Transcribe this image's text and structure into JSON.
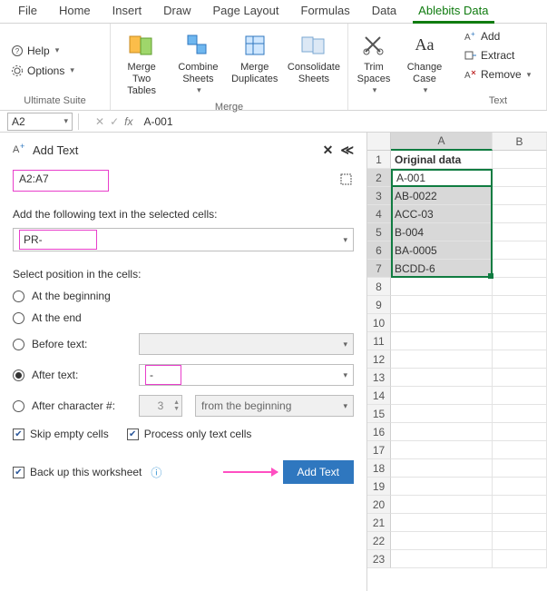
{
  "tabs": [
    "File",
    "Home",
    "Insert",
    "Draw",
    "Page Layout",
    "Formulas",
    "Data",
    "Ablebits Data"
  ],
  "active_tab": 7,
  "ribbon": {
    "ultimate": {
      "help": "Help",
      "options": "Options",
      "label": "Ultimate Suite"
    },
    "merge": {
      "mergeTables": "Merge\nTwo Tables",
      "combineSheets": "Combine\nSheets",
      "mergeDuplicates": "Merge\nDuplicates",
      "consolidateSheets": "Consolidate\nSheets",
      "label": "Merge"
    },
    "trim": {
      "label": "Trim\nSpaces"
    },
    "changeCase": {
      "label": "Change\nCase"
    },
    "text": {
      "add": "Add",
      "extract": "Extract",
      "remove": "Remove",
      "label": "Text"
    }
  },
  "formula_bar": {
    "namebox": "A2",
    "value": "A-001",
    "fx": "fx"
  },
  "pane": {
    "title": "Add Text",
    "range": "A2:A7",
    "prompt1": "Add the following text in the selected cells:",
    "text_to_add": "PR-",
    "prompt2": "Select position in the cells:",
    "opt_begin": "At the beginning",
    "opt_end": "At the end",
    "opt_before": "Before text:",
    "opt_after": "After text:",
    "after_value": "-",
    "opt_afterchar": "After character #:",
    "char_num": "3",
    "from_label": "from the beginning",
    "chk_skip": "Skip empty cells",
    "chk_textonly": "Process only text cells",
    "chk_backup": "Back up this worksheet",
    "button": "Add Text"
  },
  "grid": {
    "colA": "A",
    "colB": "B",
    "header": "Original data",
    "rows": [
      "A-001",
      "AB-0022",
      "ACC-03",
      "B-004",
      "BA-0005",
      "BCDD-6"
    ],
    "active_value": "A-001"
  },
  "chart_data": {
    "type": "table",
    "title": "Original data",
    "columns": [
      "Original data"
    ],
    "rows": [
      [
        "A-001"
      ],
      [
        "AB-0022"
      ],
      [
        "ACC-03"
      ],
      [
        "B-004"
      ],
      [
        "BA-0005"
      ],
      [
        "BCDD-6"
      ]
    ]
  }
}
